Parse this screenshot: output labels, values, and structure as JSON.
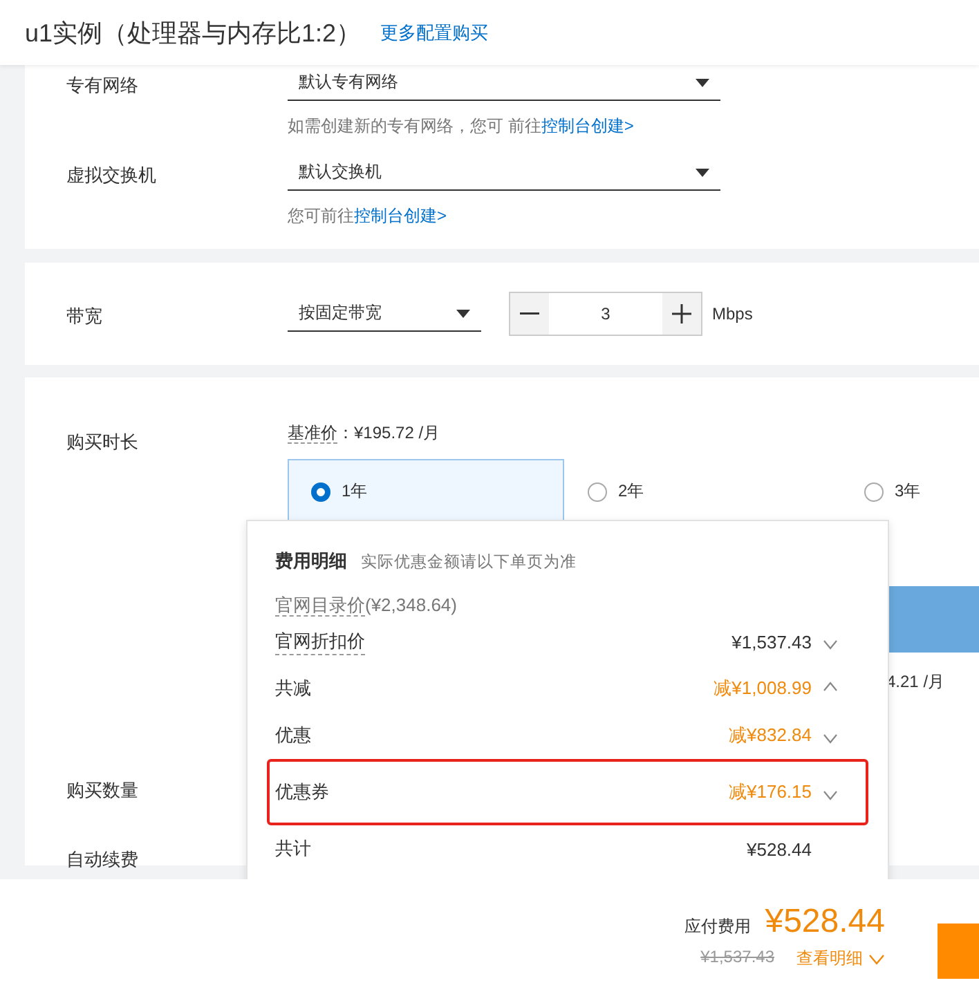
{
  "header": {
    "title": "u1实例（处理器与内存比1:2）",
    "link": "更多配置购买"
  },
  "network": [
    {
      "label": "专有网络",
      "value": "默认专有网络",
      "hint": "如需创建新的专有网络，您可 前往",
      "hint_link": "控制台创建>"
    },
    {
      "label": "虚拟交换机",
      "value": "默认交换机",
      "hint": "您可前往",
      "hint_link": "控制台创建>"
    }
  ],
  "bandwidth": {
    "label": "带宽",
    "mode": "按固定带宽",
    "value": "3",
    "unit": "Mbps"
  },
  "duration": {
    "label": "购买时长",
    "base_price_label": "基准价",
    "base_price": "：¥195.72 /月",
    "options": [
      {
        "label": "1年",
        "selected": true
      },
      {
        "label": "2年",
        "selected": false
      },
      {
        "label": "3年",
        "selected": false
      }
    ],
    "partial_price": "4.21 /月"
  },
  "quantity_label": "购买数量",
  "auto_renew_label": "自动续费",
  "cost_popup": {
    "title": "费用明细",
    "note": "实际优惠金额请以下单页为准",
    "list_price_label": "官网目录价",
    "list_price": "(¥2,348.64)",
    "rows": [
      {
        "label": "官网折扣价",
        "amount": "¥1,537.43",
        "kind": "price",
        "expanded": false,
        "highlighted": false
      },
      {
        "label": "共减",
        "amount": "减¥1,008.99",
        "kind": "discount",
        "expanded": true,
        "highlighted": false
      },
      {
        "label": "优惠",
        "amount": "减¥832.84",
        "kind": "discount",
        "expanded": false,
        "highlighted": false
      },
      {
        "label": "优惠券",
        "amount": "减¥176.15",
        "kind": "discount",
        "expanded": false,
        "highlighted": true
      },
      {
        "label": "共计",
        "amount": "¥528.44",
        "kind": "total",
        "highlighted": false
      }
    ]
  },
  "footer": {
    "payable_label": "应付费用",
    "payable": "¥528.44",
    "original": "¥1,537.43",
    "details_link": "查看明细"
  }
}
